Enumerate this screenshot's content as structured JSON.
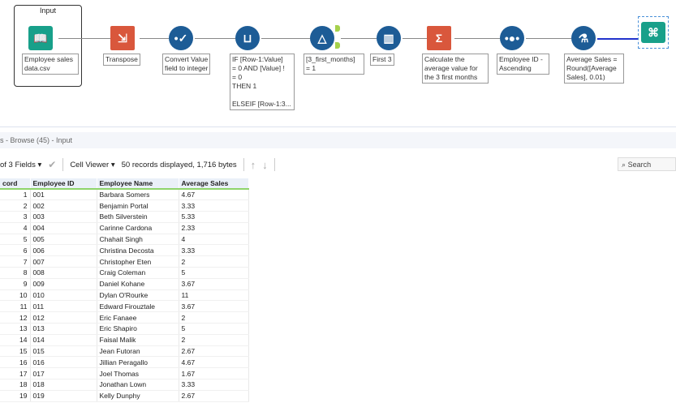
{
  "workflow": {
    "container_title": "Input",
    "tools": [
      {
        "name": "input",
        "annotation": "Employee sales\ndata.csv"
      },
      {
        "name": "transpose",
        "annotation": "Transpose"
      },
      {
        "name": "select",
        "annotation": "Convert Value\nfield to integer"
      },
      {
        "name": "multi-row-formula",
        "annotation": "IF [Row-1:Value]\n= 0 AND [Value] !\n= 0\nTHEN 1\n\nELSEIF [Row-1:3..."
      },
      {
        "name": "filter",
        "annotation": "[3_first_months]\n= 1"
      },
      {
        "name": "sample",
        "annotation": "First 3"
      },
      {
        "name": "summarize",
        "annotation": "Calculate the\naverage value for\nthe 3 first months"
      },
      {
        "name": "sort",
        "annotation": "Employee ID -\nAscending"
      },
      {
        "name": "formula",
        "annotation": "Average Sales =\nRound([Average\nSales], 0.01)"
      },
      {
        "name": "browse",
        "annotation": ""
      }
    ],
    "filter_true": "T",
    "filter_false": "F"
  },
  "results": {
    "title": "s - Browse (45) - Input",
    "fields_select": "of 3 Fields",
    "cell_viewer": "Cell Viewer",
    "status": "50 records displayed, 1,716 bytes",
    "search_placeholder": "Search",
    "columns": [
      "cord",
      "Employee ID",
      "Employee Name",
      "Average Sales"
    ],
    "rows": [
      [
        "1",
        "001",
        "Barbara Somers",
        "4.67"
      ],
      [
        "2",
        "002",
        "Benjamin Portal",
        "3.33"
      ],
      [
        "3",
        "003",
        "Beth Silverstein",
        "5.33"
      ],
      [
        "4",
        "004",
        "Carinne Cardona",
        "2.33"
      ],
      [
        "5",
        "005",
        "Chahait Singh",
        "4"
      ],
      [
        "6",
        "006",
        "Christina Decosta",
        "3.33"
      ],
      [
        "7",
        "007",
        "Christopher Eten",
        "2"
      ],
      [
        "8",
        "008",
        "Craig Coleman",
        "5"
      ],
      [
        "9",
        "009",
        "Daniel Kohane",
        "3.67"
      ],
      [
        "10",
        "010",
        "Dylan O'Rourke",
        "11"
      ],
      [
        "11",
        "011",
        "Edward Firouztale",
        "3.67"
      ],
      [
        "12",
        "012",
        "Eric Fanaee",
        "2"
      ],
      [
        "13",
        "013",
        "Eric Shapiro",
        "5"
      ],
      [
        "14",
        "014",
        "Faisal Malik",
        "2"
      ],
      [
        "15",
        "015",
        "Jean Futoran",
        "2.67"
      ],
      [
        "16",
        "016",
        "Jillian Peragallo",
        "4.67"
      ],
      [
        "17",
        "017",
        "Joel Thomas",
        "1.67"
      ],
      [
        "18",
        "018",
        "Jonathan Lown",
        "3.33"
      ],
      [
        "19",
        "019",
        "Kelly Dunphy",
        "2.67"
      ]
    ]
  }
}
